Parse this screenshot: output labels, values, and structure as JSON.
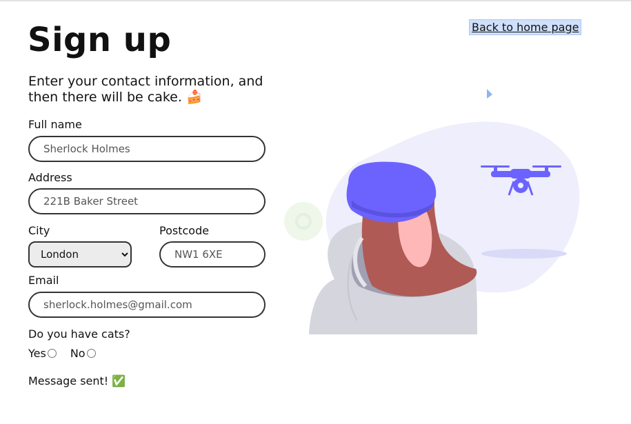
{
  "page": {
    "title": "Sign up",
    "subtitle": "Enter your contact information, and then there will be cake. 🍰",
    "back_link": "Back to home page"
  },
  "form": {
    "full_name": {
      "label": "Full name",
      "placeholder": "Sherlock Holmes"
    },
    "address": {
      "label": "Address",
      "placeholder": "221B Baker Street"
    },
    "city": {
      "label": "City",
      "selected": "London"
    },
    "postcode": {
      "label": "Postcode",
      "placeholder": "NW1 6XE"
    },
    "email": {
      "label": "Email",
      "placeholder": "sherlock.holmes@gmail.com"
    },
    "cats": {
      "question": "Do you have cats?",
      "yes": "Yes",
      "no": "No"
    }
  },
  "status": {
    "message": "Message sent! ✅"
  },
  "illustration": {
    "name": "woman-with-drone",
    "accent": "#6c63ff",
    "hair": "#b05a55",
    "skin": "#ffb8b8"
  }
}
